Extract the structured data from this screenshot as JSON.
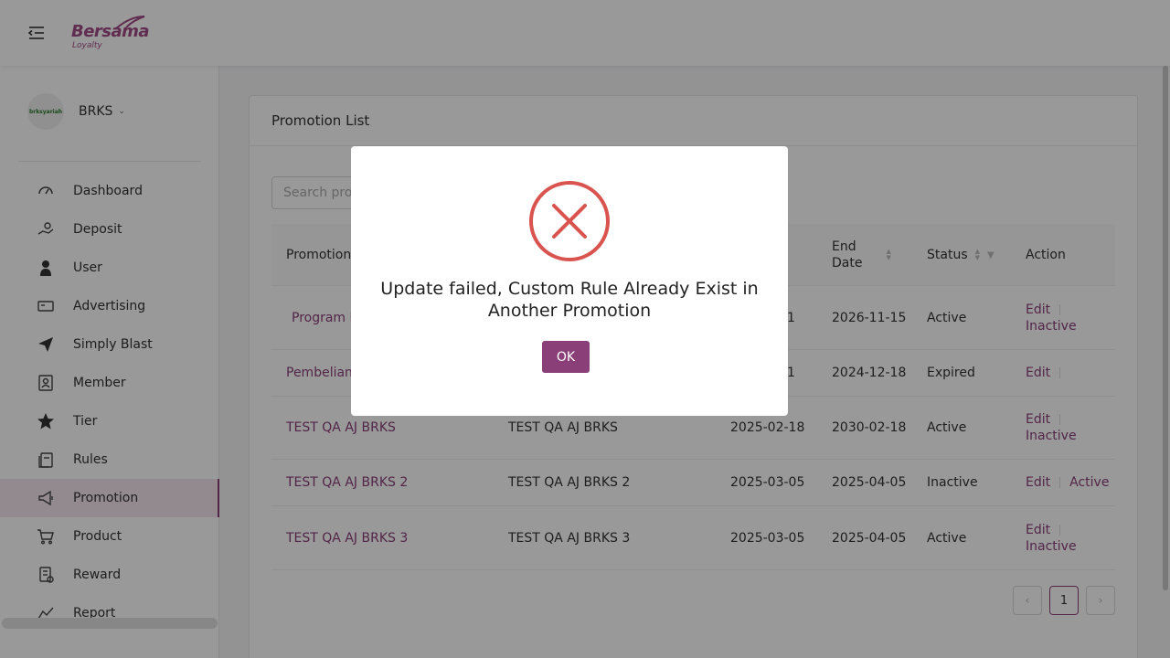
{
  "header": {
    "logo_text": "Bersama",
    "logo_sub": "Loyalty"
  },
  "sidebar": {
    "org_avatar_text": "brksyariah",
    "org_name": "BRKS",
    "items": [
      {
        "label": "Dashboard",
        "icon": "dashboard-icon"
      },
      {
        "label": "Deposit",
        "icon": "deposit-icon"
      },
      {
        "label": "User",
        "icon": "user-icon"
      },
      {
        "label": "Advertising",
        "icon": "advertising-icon"
      },
      {
        "label": "Simply Blast",
        "icon": "send-icon"
      },
      {
        "label": "Member",
        "icon": "member-icon"
      },
      {
        "label": "Tier",
        "icon": "star-icon"
      },
      {
        "label": "Rules",
        "icon": "rules-icon"
      },
      {
        "label": "Promotion",
        "icon": "megaphone-icon",
        "active": true
      },
      {
        "label": "Product",
        "icon": "cart-icon"
      },
      {
        "label": "Reward",
        "icon": "reward-icon"
      },
      {
        "label": "Report",
        "icon": "chart-line-icon"
      }
    ]
  },
  "main": {
    "title": "Promotion List",
    "search_placeholder": "Search promotion",
    "columns": {
      "promotion": "Promotion",
      "end_date_line1": "End",
      "end_date_line2": "Date",
      "status": "Status",
      "action": "Action"
    },
    "rows": [
      {
        "name": "Program L",
        "desc": "",
        "start": "1",
        "end": "2026-11-15",
        "status": "Active",
        "edit": "Edit",
        "toggle": "Inactive"
      },
      {
        "name": "Pembelian T",
        "desc": "",
        "start": "1",
        "end": "2024-12-18",
        "status": "Expired",
        "edit": "Edit",
        "toggle": ""
      },
      {
        "name": "TEST QA AJ BRKS",
        "desc": "TEST QA AJ BRKS",
        "start": "2025-02-18",
        "end": "2030-02-18",
        "status": "Active",
        "edit": "Edit",
        "toggle": "Inactive"
      },
      {
        "name": "TEST QA AJ BRKS 2",
        "desc": "TEST QA AJ BRKS 2",
        "start": "2025-03-05",
        "end": "2025-04-05",
        "status": "Inactive",
        "edit": "Edit",
        "toggle": "Active"
      },
      {
        "name": "TEST QA AJ BRKS 3",
        "desc": "TEST QA AJ BRKS 3",
        "start": "2025-03-05",
        "end": "2025-04-05",
        "status": "Active",
        "edit": "Edit",
        "toggle": "Inactive"
      }
    ],
    "pagination": {
      "prev": "‹",
      "current": "1",
      "next": "›"
    }
  },
  "modal": {
    "message": "Update failed, Custom Rule Already Exist in Another Promotion",
    "ok_label": "OK",
    "icon": "error-x-icon",
    "icon_color": "#d9534f"
  },
  "colors": {
    "accent": "#8a3f78",
    "error": "#d9534f"
  }
}
